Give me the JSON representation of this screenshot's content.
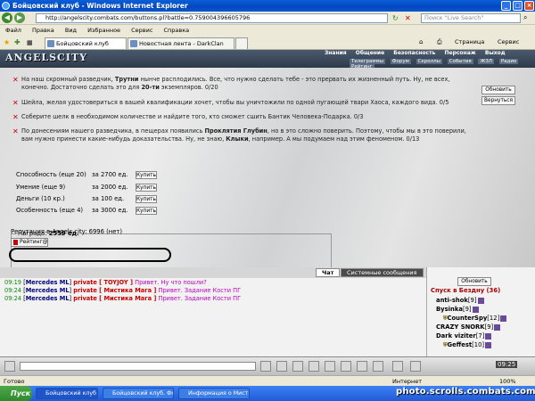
{
  "window": {
    "title": "Бойцовский клуб - Windows Internet Explorer"
  },
  "address": {
    "url": "http://angelscity.combats.com/buttons.pl?battle=0.759004396605796",
    "search_placeholder": "Поиск \"Live Search\""
  },
  "menu": [
    "Файл",
    "Правка",
    "Вид",
    "Избранное",
    "Сервис",
    "Справка"
  ],
  "browser_tabs": [
    {
      "label": "Бойцовский клуб",
      "active": true
    },
    {
      "label": "Новостная лента - DarkClan",
      "active": false
    }
  ],
  "toolbar_right": {
    "page": "Страница",
    "tools": "Сервис"
  },
  "game": {
    "logo": "ANGELSCITY",
    "nav": [
      "Знания",
      "Общение",
      "Безопасность",
      "Персонаж",
      "Выход"
    ],
    "subnav": [
      "Телеграммы",
      "Форум",
      "Скроллы",
      "События",
      "ЖЗЛ",
      "Радио",
      "Рейтинг"
    ]
  },
  "quests": [
    {
      "text_before": "На наш скромный разведчик, ",
      "bold": "Трутни",
      "text_after": " нынче расплодились. Все, что нужно сделать тебе - это прервать их жизненный путь. Ну, не всех, конечно. Достаточно сделать это для ",
      "bold2": "20-ти",
      "text_end": " экземпляров. 0/20"
    },
    {
      "text_before": "Шейла, желая удостовериться в вашей квалификации хочет, чтобы вы уничтожили по одной пугающей твари Хаоса, каждого вида. 0/5",
      "bold": "",
      "text_after": "",
      "bold2": "",
      "text_end": ""
    },
    {
      "text_before": "Соберите шелк в необходимом количестве и найдите того, кто сможет сшить Бантик Человека-Подарка. 0/3",
      "bold": "",
      "text_after": "",
      "bold2": "",
      "text_end": ""
    },
    {
      "text_before": "По донесениям нашего разведчика, в пещерах появились ",
      "bold": "Проклятия Глубин",
      "text_after": ", но в это сложно поверить. Поэтому, чтобы мы в это поверили, вам нужно принести какие-нибудь доказательства. Ну, не знаю, ",
      "bold2": "Клыки",
      "text_end": ", например. А мы подумаем над этим феноменом. 0/13"
    }
  ],
  "buttons": {
    "refresh": "Обновить",
    "back": "Вернуться",
    "refresh_chat": "Обновить"
  },
  "reward": {
    "label": "Награда:",
    "amount": "2559 ед.",
    "rows": [
      {
        "name": "Способность (еще 20)",
        "cost": "за 2700 ед.",
        "button": "Купить"
      },
      {
        "name": "Умение (еще 9)",
        "cost": "за 2000 ед.",
        "button": "Купить"
      },
      {
        "name": "Деньги (10 кр.)",
        "cost": "за 100 ед.",
        "button": "Купить"
      },
      {
        "name": "Особенность (еще 4)",
        "cost": "за 3000 ед.",
        "button": "Купить"
      }
    ]
  },
  "reputation": "Репутация в Angels city: 6996 (нет)",
  "rating_button": "Рейтинг@",
  "chat_tabs": {
    "chat": "Чат",
    "system": "Системные сообщения"
  },
  "chat": [
    {
      "time": "09:19",
      "sender": "Mercedes ML",
      "private": "private [ TOYJOY ]",
      "message": "Привет. Ну что пошли?"
    },
    {
      "time": "09:24",
      "sender": "Mercedes ML",
      "private": "private [ Мистика Мага ]",
      "message": "Привет. Задание Кости ПГ"
    },
    {
      "time": "09:24",
      "sender": "Mercedes ML",
      "private": "private [ Мистика Мага ]",
      "message": "Привет. Задание Кости ПГ"
    }
  ],
  "online": {
    "title": "Спуск в Бездну (36)",
    "users": [
      {
        "name": "anti-shok",
        "level": "[9]"
      },
      {
        "name": "Bysinka",
        "level": "[9]"
      },
      {
        "name": "CounterSpy",
        "level": "[12]"
      },
      {
        "name": "CRAZY SNORK",
        "level": "[9]"
      },
      {
        "name": "Dark viziter",
        "level": "[7]"
      },
      {
        "name": "Geffest",
        "level": "[10]"
      }
    ]
  },
  "clock": "09:25",
  "status": {
    "left": "Готово",
    "zone": "Интернет",
    "zoom": "100%"
  },
  "taskbar": {
    "start": "Пуск",
    "items": [
      "Бойцовский клуб - ...",
      "Бойцовский клуб. Фору...",
      "Информация о Мистик..."
    ],
    "watermark": "photo.scrolls.combats.com"
  }
}
